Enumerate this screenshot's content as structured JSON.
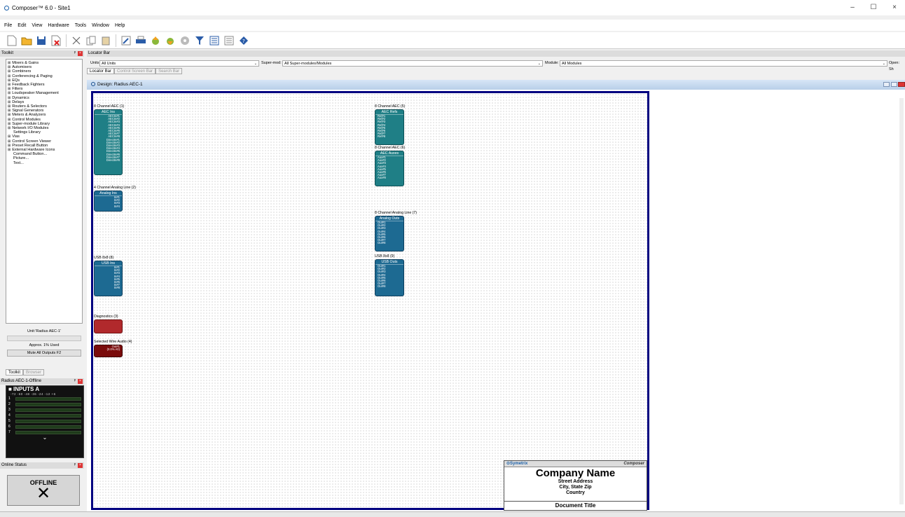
{
  "window": {
    "title": "Composer™ 6.0 - Site1",
    "minimize": "–",
    "maximize": "☐",
    "close": "×"
  },
  "menu": [
    "File",
    "Edit",
    "View",
    "Hardware",
    "Tools",
    "Window",
    "Help"
  ],
  "toolkit": {
    "header": "Toolkit",
    "pin": "ᵖ",
    "items": [
      {
        "label": "Mixers & Gains",
        "expandable": true
      },
      {
        "label": "Automixers",
        "expandable": true
      },
      {
        "label": "Combiners",
        "expandable": true
      },
      {
        "label": "Conferencing & Paging",
        "expandable": true
      },
      {
        "label": "EQs",
        "expandable": true
      },
      {
        "label": "Feedback Fighters",
        "expandable": true
      },
      {
        "label": "Filters",
        "expandable": true
      },
      {
        "label": "Loudspeaker Management",
        "expandable": true
      },
      {
        "label": "Dynamics",
        "expandable": true
      },
      {
        "label": "Delays",
        "expandable": true
      },
      {
        "label": "Routers & Selectors",
        "expandable": true
      },
      {
        "label": "Signal Generators",
        "expandable": true
      },
      {
        "label": "Meters & Analyzers",
        "expandable": true
      },
      {
        "label": "Control Modules",
        "expandable": true
      },
      {
        "label": "Super-module Library",
        "expandable": true
      },
      {
        "label": "Network I/O Modules",
        "expandable": true
      },
      {
        "label": "Settings Library",
        "expandable": false
      },
      {
        "label": "Vias",
        "expandable": true
      },
      {
        "label": "Control Screen Viewer",
        "expandable": true
      },
      {
        "label": "Preset Recall Button",
        "expandable": true
      },
      {
        "label": "External Hardware Icons",
        "expandable": true
      },
      {
        "label": "Command Button...",
        "expandable": false
      },
      {
        "label": "Picture...",
        "expandable": false
      },
      {
        "label": "Text...",
        "expandable": false
      }
    ],
    "unit_label": "Unit:'Radius AEC-1'",
    "usage": "Approx.  1% Used",
    "mute_button": "Mute All Outputs  F2",
    "tabs": [
      "Toolkit",
      "Browser"
    ]
  },
  "meter_panel": {
    "header": "Radius AEC-1-Offline",
    "title": "■ INPUTS A",
    "scale": "-72   -60   -48   -36   -24   -12   +6",
    "channels": [
      "1",
      "2",
      "3",
      "4",
      "5",
      "6",
      "7"
    ],
    "more": "⌄"
  },
  "online_status": {
    "header": "Online Status",
    "state": "OFFLINE",
    "mark": "✕"
  },
  "locator": {
    "header": "Locator Bar",
    "units_label": "Units:",
    "units_value": "All Units",
    "supermod_label": "Super-mod:",
    "supermod_value": "All Super-modules/Modules",
    "module_label": "Module:",
    "module_value": "All Modules",
    "open_label": "Open: Sh",
    "tabs": [
      "Locator Bar",
      "Control Screen Bar",
      "Search Bar"
    ]
  },
  "design": {
    "title": "Design: Radius AEC-1",
    "modules": [
      {
        "label": "8 Channel AEC (1)",
        "title": "AEC Ins",
        "pins": [
          "AECIn#1",
          "AECIn#2",
          "AECIn#3",
          "AECIn#4",
          "AECIn#5",
          "AECIn#6",
          "AECIn#7",
          "AECIn#8",
          "DirectIn#1",
          "DirectIn#2",
          "DirectIn#3",
          "DirectIn#4",
          "DirectIn#5",
          "DirectIn#6",
          "DirectIn#7",
          "DirectIn#8"
        ],
        "color": "teal",
        "dir": "out"
      },
      {
        "label": "4 Channel Analog Line (2)",
        "title": "Analog Ins",
        "pins": [
          "In#1",
          "In#2",
          "In#3",
          "In#4"
        ],
        "color": "blue",
        "dir": "out"
      },
      {
        "label": "USB 8x8 (8)",
        "title": "USB Ins",
        "pins": [
          "In#1",
          "In#2",
          "In#3",
          "In#4",
          "In#5",
          "In#6",
          "In#7",
          "In#8"
        ],
        "color": "blue",
        "dir": "out"
      },
      {
        "label": "Diagnostics (3)",
        "title": "",
        "pins": [],
        "color": "red",
        "dir": "out"
      },
      {
        "label": "Selected Wire Audio (4)",
        "title": "",
        "pins": [
          "Out#1",
          "(0.0% A0)"
        ],
        "color": "maroon",
        "dir": "out"
      },
      {
        "label": "8 Channel AEC (5)",
        "title": "AEC Refs",
        "pins": [
          "Ref#1",
          "Ref#2",
          "Ref#3",
          "Ref#4",
          "Ref#5",
          "Ref#6",
          "Ref#7",
          "Ref#8"
        ],
        "color": "teal",
        "dir": "in"
      },
      {
        "label": "8 Channel AEC (6)",
        "title": "AEC Auxes",
        "pins": [
          "Aux#1",
          "Aux#2",
          "Aux#3",
          "Aux#4",
          "Aux#5",
          "Aux#6",
          "Aux#7",
          "Aux#8"
        ],
        "color": "teal",
        "dir": "in"
      },
      {
        "label": "8 Channel Analog Line (7)",
        "title": "Analog Outs",
        "pins": [
          "Out#1",
          "Out#2",
          "Out#3",
          "Out#4",
          "Out#5",
          "Out#6",
          "Out#7",
          "Out#8"
        ],
        "color": "blue",
        "dir": "in"
      },
      {
        "label": "USB 8x8 (9)",
        "title": "USB Outs",
        "pins": [
          "Out#1",
          "Out#2",
          "Out#3",
          "Out#4",
          "Out#5",
          "Out#6",
          "Out#7",
          "Out#8"
        ],
        "color": "blue",
        "dir": "in"
      }
    ],
    "title_block": {
      "brand": "⊙Symetrix",
      "product": "Composer",
      "company": "Company Name",
      "street": "Street Address",
      "city": "City, State  Zip",
      "country": "Country",
      "document": "Document Title"
    }
  }
}
